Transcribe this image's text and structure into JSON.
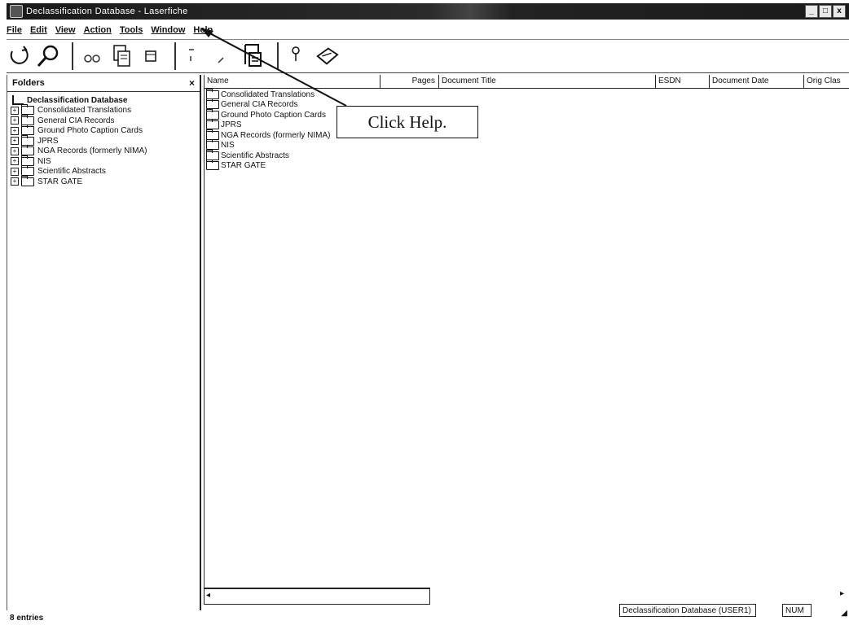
{
  "window": {
    "title": "Declassification Database - Laserfiche",
    "minimize_glyph": "_",
    "maximize_glyph": "□",
    "close_glyph": "x"
  },
  "menu": {
    "items": [
      "File",
      "Edit",
      "View",
      "Action",
      "Tools",
      "Window",
      "Help"
    ]
  },
  "toolbar": {
    "buttons": [
      {
        "icon": "new-folder-icon"
      },
      {
        "icon": "search-icon"
      },
      {
        "icon": "binoculars-icon"
      },
      {
        "icon": "copy-document-icon"
      },
      {
        "icon": "paste-icon"
      },
      {
        "icon": "refresh-icon"
      },
      {
        "icon": "edit-icon"
      },
      {
        "icon": "scan-icon"
      },
      {
        "icon": "pin-icon"
      },
      {
        "icon": "briefcase-icon"
      }
    ]
  },
  "folders_pane": {
    "title": "Folders",
    "close": "×",
    "root": "Declassification Database",
    "items": [
      "Consolidated Translations",
      "General CIA Records",
      "Ground Photo Caption Cards",
      "JPRS",
      "NGA Records (formerly NIMA)",
      "NIS",
      "Scientific Abstracts",
      "STAR GATE"
    ]
  },
  "list": {
    "columns": [
      "Name",
      "Pages",
      "Document Title",
      "ESDN",
      "Document Date",
      "Orig Clas"
    ],
    "rows": [
      "Consolidated Translations",
      "General CIA Records",
      "Ground Photo Caption Cards",
      "JPRS",
      "NGA Records (formerly NIMA)",
      "NIS",
      "Scientific Abstracts",
      "STAR GATE"
    ]
  },
  "annotation": {
    "text": "Click Help."
  },
  "status": {
    "entries": "8 entries",
    "database": "Declassification Database (USER1)",
    "num": "NUM"
  }
}
